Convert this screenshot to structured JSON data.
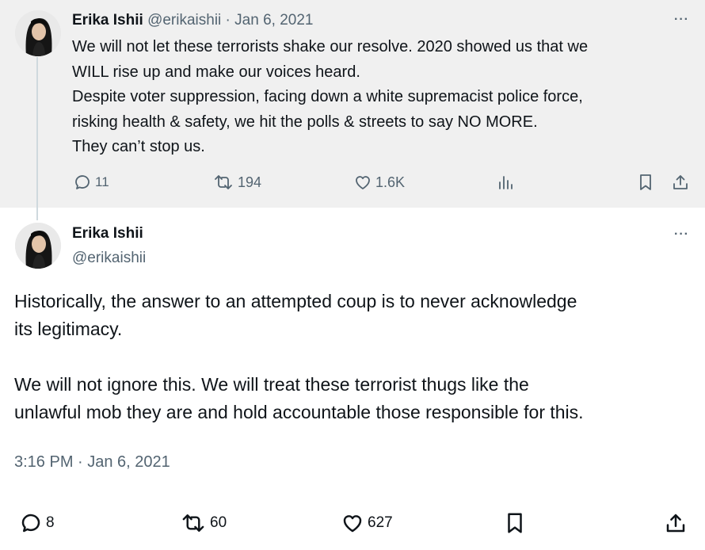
{
  "parent_tweet": {
    "author_name": "Erika Ishii",
    "handle": "@erikaishii",
    "separator": " · ",
    "date": "Jan 6, 2021",
    "more_label": "···",
    "text": "We will not let these terrorists shake our resolve. 2020 showed us that we\nWILL rise up and make our voices heard.\nDespite voter suppression, facing down a white supremacist police force,\nrisking health & safety, we hit the polls & streets to say NO MORE.\nThey can’t stop us.",
    "replies": "11",
    "reposts": "194",
    "likes": "1.6K",
    "icons": [
      "reply-icon",
      "repost-icon",
      "like-icon",
      "views-icon",
      "bookmark-icon",
      "share-icon"
    ]
  },
  "main_tweet": {
    "author_name": "Erika Ishii",
    "handle": "@erikaishii",
    "more_label": "···",
    "text": "Historically, the answer to an attempted coup is to never acknowledge\nits legitimacy.\n\nWe will not ignore this. We will treat these terrorist thugs like the\nunlawful mob they are and hold accountable those responsible for this.",
    "timestamp": "3:16 PM · Jan 6, 2021",
    "replies": "8",
    "reposts": "60",
    "likes": "627",
    "icons": [
      "reply-icon",
      "repost-icon",
      "like-icon",
      "bookmark-icon",
      "share-icon"
    ]
  },
  "colors": {
    "parent_background": "#f0f0f0",
    "text": "#0f1419",
    "muted": "#536471",
    "thread_line": "#cfd9de"
  }
}
